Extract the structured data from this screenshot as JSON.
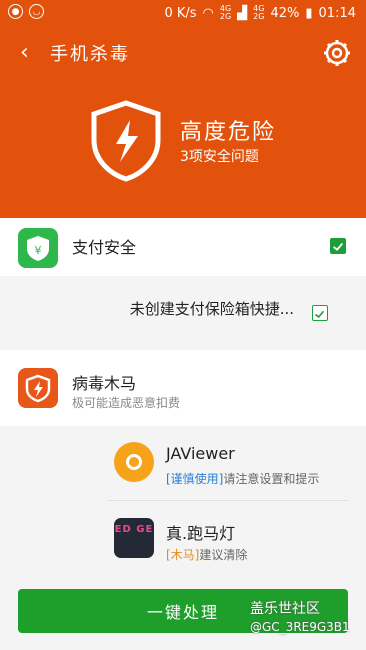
{
  "status_bar": {
    "net_speed": "0 K/s",
    "net_4g_top": "4G",
    "net_4g_bottom": "2G",
    "sim_4g_top": "4G",
    "sim_4g_bottom": "2G",
    "battery": "42%",
    "time": "01:14",
    "icons": [
      "app-icon-1",
      "app-icon-2",
      "wifi-icon",
      "signal-icon",
      "battery-icon"
    ]
  },
  "header": {
    "title": "手机杀毒",
    "risk_title": "高度危险",
    "risk_subtitle": "3项安全问题",
    "colors": {
      "header_bg": "#e2520d",
      "accent_green": "#1e9e2a"
    }
  },
  "payment": {
    "label": "支付安全",
    "sub_label": "未创建支付保险箱快捷...",
    "checked": true
  },
  "virus": {
    "label": "病毒木马",
    "subtitle": "极可能造成恶意扣费"
  },
  "apps": [
    {
      "name": "JAViewer",
      "tag": "[谨慎使用]",
      "desc": "请注意设置和提示"
    },
    {
      "name": "真.跑马灯",
      "icon_text": "ED GE",
      "tag": "[木马]",
      "desc": "建议清除"
    }
  ],
  "action_button": {
    "label": "一键处理"
  },
  "watermark": {
    "line1": "盖乐世社区",
    "line2": "@GC_3RE9G3B1"
  }
}
